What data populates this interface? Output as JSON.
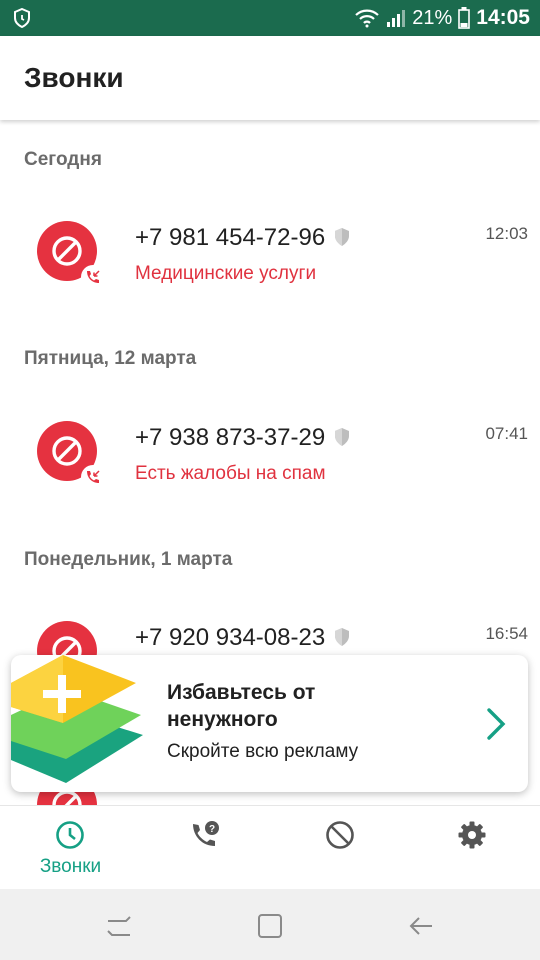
{
  "status_bar": {
    "battery": "21%",
    "time": "14:05"
  },
  "app_bar": {
    "title": "Звонки"
  },
  "sections": [
    {
      "header": "Сегодня",
      "phone": "+7 981 454-72-96",
      "label": "Медицинские услуги",
      "time": "12:03"
    },
    {
      "header": "Пятница, 12 марта",
      "phone": "+7 938 873-37-29",
      "label": "Есть жалобы на спам",
      "time": "07:41"
    },
    {
      "header": "Понедельник, 1 марта",
      "phone": "+7 920 934-08-23",
      "label": "",
      "time": "16:54"
    }
  ],
  "promo": {
    "title": "Избавьтесь от ненужного",
    "subtitle": "Скройте всю рекламу"
  },
  "bottom_nav": [
    {
      "label": "Звонки",
      "icon": "clock-icon",
      "active": true
    },
    {
      "label": "",
      "icon": "phone-question-icon",
      "active": false
    },
    {
      "label": "",
      "icon": "block-icon",
      "active": false
    },
    {
      "label": "",
      "icon": "gear-icon",
      "active": false
    }
  ],
  "colors": {
    "status_bar": "#1b6b4e",
    "accent": "#16a085",
    "spam_red": "#e53240"
  }
}
